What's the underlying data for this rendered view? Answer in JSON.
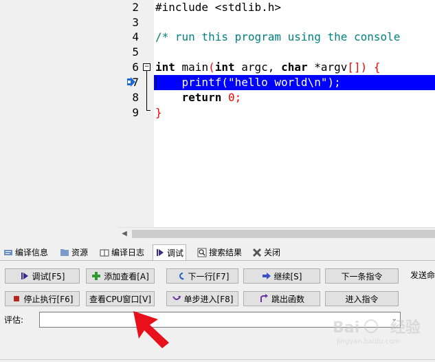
{
  "editor": {
    "line_numbers": [
      "2",
      "3",
      "4",
      "5",
      "6",
      "7",
      "8",
      "9"
    ],
    "lines": {
      "l2": "#include <stdlib.h>",
      "l4": "/* run this program using the console",
      "l6_kw1": "int",
      "l6_a": " main",
      "l6_p1": "(",
      "l6_kw2": "int",
      "l6_b": " argc, ",
      "l6_kw3": "char",
      "l6_star": " *",
      "l6_c": "argv",
      "l6_br": "[])",
      "l6_brace": " {",
      "l7": "    printf(\"hello world\\n\");",
      "l8_kw": "    return",
      "l8_num": " 0",
      "l8_semi": ";",
      "l9": "}"
    }
  },
  "tabs": [
    {
      "label": "编译信息",
      "icon": "compile-info-icon"
    },
    {
      "label": "资源",
      "icon": "resources-icon"
    },
    {
      "label": "编译日志",
      "icon": "compile-log-icon"
    },
    {
      "label": "调试",
      "icon": "debug-icon"
    },
    {
      "label": "搜索结果",
      "icon": "search-results-icon"
    },
    {
      "label": "关闭",
      "icon": "close-icon"
    }
  ],
  "debug": {
    "buttons": {
      "debug": "调试[F5]",
      "add_watch": "添加查看[A]",
      "next_line": "下一行[F7]",
      "continue": "继续[S]",
      "next_instr": "下一条指令",
      "stop": "停止执行[F6]",
      "cpu_window": "查看CPU窗口[V]",
      "step_into": "单步进入[F8]",
      "step_out": "跳出函数",
      "into_instr": "进入指令"
    },
    "send_label": "发送命",
    "eval_label": "评估:",
    "eval_value": ""
  },
  "watermark": {
    "brand": "Bai",
    "brand2": "经验",
    "sub": "jingyan.baidu.com"
  },
  "colors": {
    "selection": "#0000ff",
    "comment": "#008080",
    "keyword_red": "#ff0000",
    "arrow_red": "#e8101b"
  }
}
